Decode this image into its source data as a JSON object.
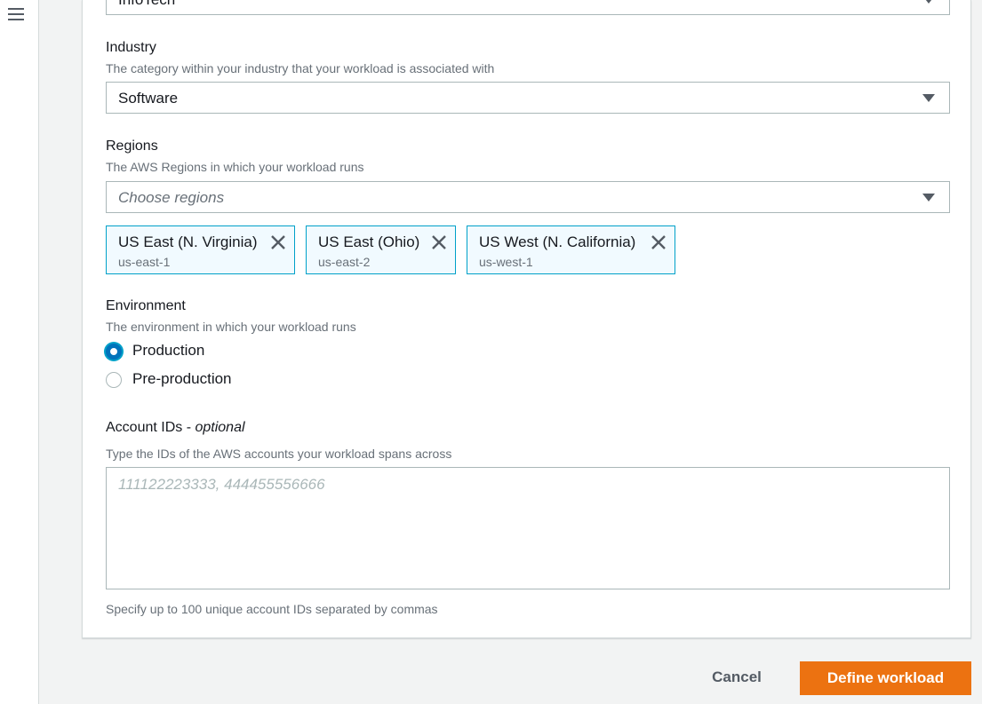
{
  "previous_select": {
    "value": "InfoTech"
  },
  "industry": {
    "label": "Industry",
    "description": "The category within your industry that your workload is associated with",
    "value": "Software"
  },
  "regions": {
    "label": "Regions",
    "description": "The AWS Regions in which your workload runs",
    "placeholder": "Choose regions",
    "tokens": [
      {
        "name": "US East (N. Virginia)",
        "code": "us-east-1"
      },
      {
        "name": "US East (Ohio)",
        "code": "us-east-2"
      },
      {
        "name": "US West (N. California)",
        "code": "us-west-1"
      }
    ]
  },
  "environment": {
    "label": "Environment",
    "description": "The environment in which your workload runs",
    "options": [
      {
        "label": "Production",
        "selected": true
      },
      {
        "label": "Pre-production",
        "selected": false
      }
    ]
  },
  "account_ids": {
    "label": "Account IDs - ",
    "label_optional": "optional",
    "description": "Type the IDs of the AWS accounts your workload spans across",
    "placeholder": "111122223333, 444455556666",
    "constraint": "Specify up to 100 unique account IDs separated by commas"
  },
  "actions": {
    "cancel": "Cancel",
    "submit": "Define workload"
  },
  "colors": {
    "primary_button": "#ec7211",
    "selected_accent": "#0073bb",
    "token_border": "#00a1c9"
  }
}
